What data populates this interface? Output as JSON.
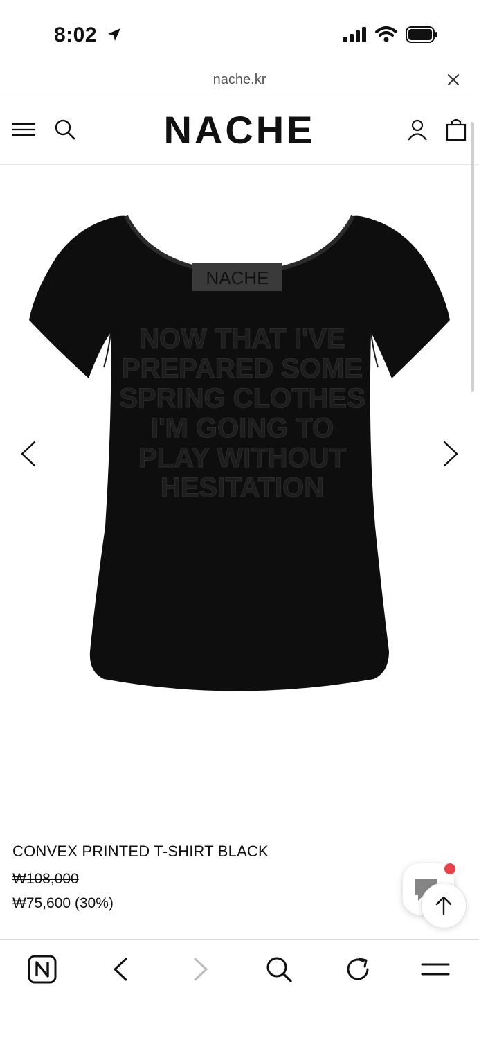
{
  "status_bar": {
    "time": "8:02",
    "icons": [
      "location-arrow-icon",
      "signal-icon",
      "wifi-icon",
      "battery-icon"
    ]
  },
  "browser": {
    "url": "nache.kr"
  },
  "header": {
    "logo": "NACHE",
    "icons": [
      "menu-icon",
      "search-icon",
      "account-icon",
      "cart-icon"
    ]
  },
  "product": {
    "image_label": "NACHE",
    "print_text": [
      "NOW THAT I'VE",
      "PREPARED SOME",
      "SPRING CLOTHES",
      "I'M GOING TO",
      "PLAY WITHOUT",
      "HESITATION"
    ],
    "name": "CONVEX PRINTED T-SHIRT BLACK",
    "original_price": "₩108,000",
    "sale_price": "₩75,600 (30%)"
  },
  "floating": {
    "notification_color": "#e8424b"
  },
  "toolbar": {
    "items": [
      "naver-home-icon",
      "back-icon",
      "forward-icon",
      "search-icon",
      "reload-icon",
      "menu-icon"
    ]
  }
}
